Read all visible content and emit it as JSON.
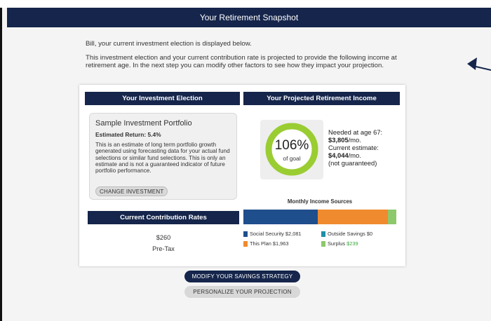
{
  "header": {
    "title": "Your Retirement Snapshot"
  },
  "intro": {
    "line1": "Bill, your current investment election is displayed below.",
    "line2": "This investment election and your current contribution rate is projected to provide the following income at retirement age. In the next step you can modify other factors to see how they impact your projection."
  },
  "election": {
    "header": "Your Investment Election",
    "portfolio_name": "Sample Investment Portfolio",
    "estimated_return": "Estimated Return: 5.4%",
    "description": "This is an estimate of long term portfolio growth generated using forecasting data for your actual fund selections or similar fund selections. This is only an estimate and is not a guaranteed indicator of future portfolio performance.",
    "change_button": "CHANGE INVESTMENT"
  },
  "projected": {
    "header": "Your Projected Retirement Income",
    "gauge_percent": "106%",
    "gauge_percent_value": 1.06,
    "gauge_label": "of goal",
    "needed_label": "Needed at age 67:",
    "needed_amount": "$3,805",
    "needed_unit": "/mo.",
    "current_label": "Current estimate:",
    "current_amount": "$4,044",
    "current_unit": "/mo.",
    "current_note": "(not guaranteed)"
  },
  "monthly_sources": {
    "title": "Monthly Income Sources",
    "items": [
      {
        "label": "Social Security $2,081",
        "value": 2081,
        "color": "#1f4e8c"
      },
      {
        "label": "Outside Savings $0",
        "value": 0,
        "color": "#1f8fa8"
      },
      {
        "label": "This Plan $1,963",
        "value": 1963,
        "color": "#f08a2e"
      },
      {
        "label_prefix": "Surplus ",
        "label_value": "$239",
        "value": 239,
        "color": "#8dc86b"
      }
    ]
  },
  "contribution": {
    "header": "Current Contribution Rates",
    "amount": "$260",
    "type": "Pre-Tax"
  },
  "actions": {
    "modify": "MODIFY YOUR SAVINGS STRATEGY",
    "personalize": "PERSONALIZE YOUR PROJECTION"
  },
  "colors": {
    "navy": "#15254b",
    "gauge": "#9acd32",
    "surplus_text": "#3aa53a"
  }
}
